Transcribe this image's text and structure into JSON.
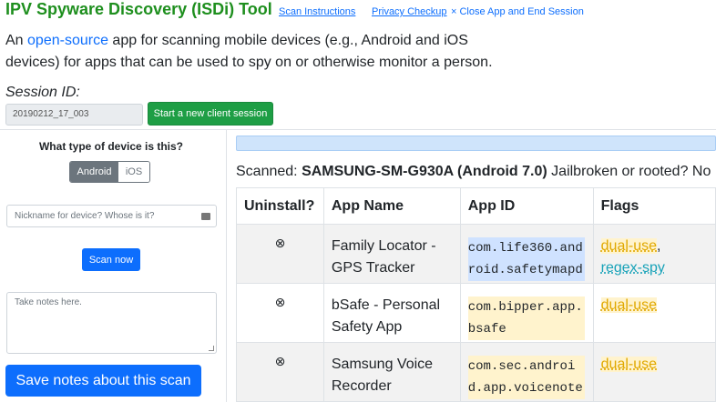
{
  "header": {
    "title": "IPV Spyware Discovery (ISDi) Tool",
    "nav": {
      "scan_instructions": "Scan Instructions",
      "privacy_checkup": "Privacy Checkup",
      "close_app": "× Close App and End Session"
    }
  },
  "intro": {
    "prefix": "An ",
    "link": "open-source",
    "suffix": " app for scanning mobile devices (e.g., Android and iOS devices) for apps that can be used to spy on or otherwise monitor a person."
  },
  "session": {
    "label": "Session ID:",
    "value": "20190212_17_003",
    "new_session_label": "Start a new client session"
  },
  "sidebar": {
    "device_question": "What type of device is this?",
    "device_options": [
      "Android",
      "iOS"
    ],
    "device_selected": "Android",
    "nickname_placeholder": "Nickname for device? Whose is it?",
    "scan_label": "Scan now",
    "notes_placeholder": "Take notes here.",
    "save_notes_label": "Save notes about this scan"
  },
  "scan": {
    "scanned_prefix": "Scanned: ",
    "device": "SAMSUNG-SM-G930A (Android 7.0)",
    "jailbreak_text": " Jailbroken or rooted? No"
  },
  "table": {
    "headers": [
      "Uninstall?",
      "App Name",
      "App ID",
      "Flags"
    ],
    "uninstall_icon": "⊗",
    "rows": [
      {
        "name": "Family Locator - GPS Tracker",
        "app_id": "com.life360.android.safetymapd",
        "flags": [
          "dual-use",
          "regex-spy"
        ]
      },
      {
        "name": "bSafe - Personal Safety App",
        "app_id": "com.bipper.app.bsafe",
        "flags": [
          "dual-use"
        ]
      },
      {
        "name": "Samsung Voice Recorder",
        "app_id": "com.sec.android.app.voicenote",
        "flags": [
          "dual-use"
        ]
      }
    ]
  },
  "colors": {
    "title_green": "#1e8f1e",
    "link_blue": "#0d6efd",
    "success_green": "#1e9e45",
    "flag_dual_use": "#e0a800",
    "flag_regex_spy": "#17a2b8"
  }
}
